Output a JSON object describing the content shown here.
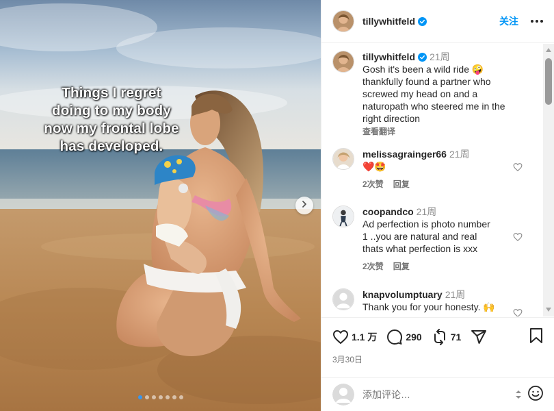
{
  "post": {
    "overlay_lines": [
      "Things I regret",
      "doing to my body",
      "now my frontal lobe",
      "has developed."
    ],
    "carousel_count": 7,
    "carousel_active": 0
  },
  "header": {
    "username": "tillywhitfeld",
    "follow_label": "关注"
  },
  "caption": {
    "username": "tillywhitfeld",
    "time": "21周",
    "lines": [
      "Gosh it's been a wild ride 🤪",
      "thankfully found a partner who",
      "screwed my head on and a",
      "naturopath who steered me in the",
      "right direction"
    ],
    "see_translation": "查看翻译"
  },
  "comments": [
    {
      "username": "melissagrainger66",
      "time": "21周",
      "text": "❤️🤩",
      "likes": "2次赞",
      "reply": "回复"
    },
    {
      "username": "coopandco",
      "time": "21周",
      "lines": [
        "Ad perfection is photo number",
        "1 ..you are natural and real",
        "thats what perfection is xxx"
      ],
      "likes": "2次赞",
      "reply": "回复"
    },
    {
      "username": "knapvolumptuary",
      "time": "21周",
      "text": "Thank you for your honesty. 🙌"
    }
  ],
  "actions": {
    "likes": "1.1 万",
    "comments": "290",
    "reposts": "71",
    "date": "3月30日"
  },
  "composer": {
    "placeholder": "添加评论…"
  },
  "colors": {
    "accent": "#0095f6",
    "verified": "#0095f6",
    "like_red": "#ed4956"
  }
}
